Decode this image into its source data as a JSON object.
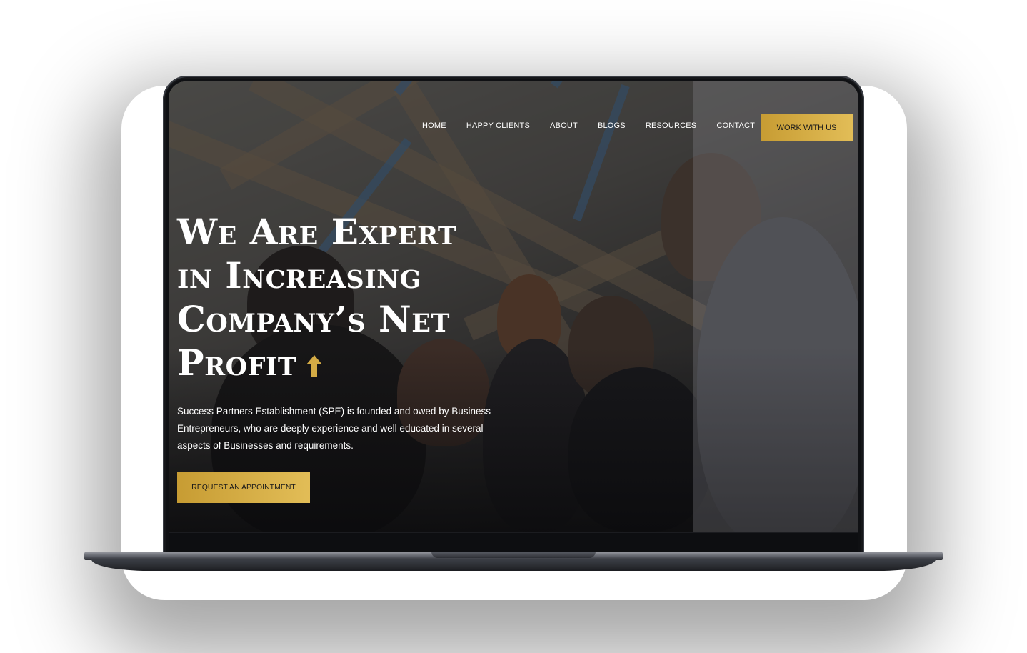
{
  "nav": {
    "items": [
      {
        "label": "HOME"
      },
      {
        "label": "HAPPY CLIENTS"
      },
      {
        "label": "ABOUT"
      },
      {
        "label": "BLOGS"
      },
      {
        "label": "RESOURCES"
      },
      {
        "label": "CONTACT"
      }
    ],
    "cta_label": "WORK WITH US"
  },
  "hero": {
    "headline_lines": [
      "We Are Expert",
      "in Increasing",
      "Company’s Net",
      "Profit"
    ],
    "arrow_icon": "arrow-up-icon",
    "intro": "Success Partners Establishment (SPE) is founded and owed by Business Entrepreneurs, who are deeply experience and well educated in several aspects of Businesses and requirements.",
    "button_label": "REQUEST AN APPOINTMENT"
  },
  "colors": {
    "accent": "#d4ab45",
    "text": "#ffffff",
    "bezel": "#0f1013"
  }
}
